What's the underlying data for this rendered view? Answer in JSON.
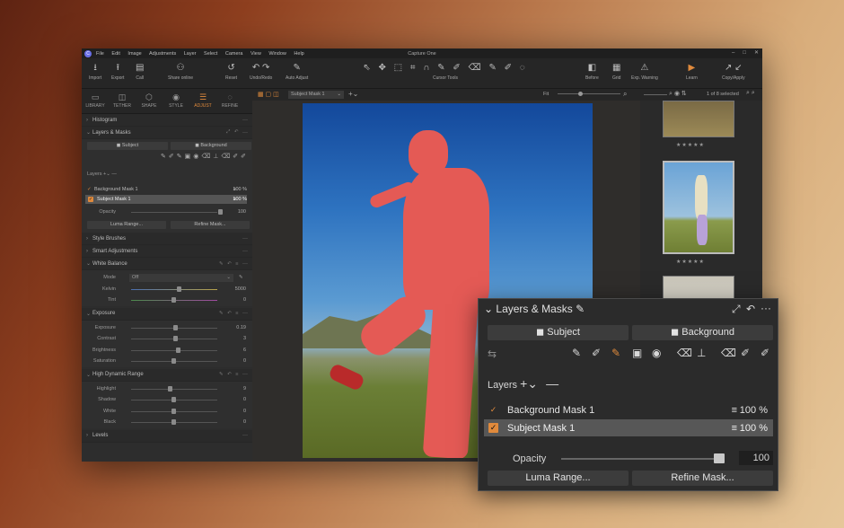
{
  "titlebar": {
    "menus": [
      "File",
      "Edit",
      "Image",
      "Adjustments",
      "Layer",
      "Select",
      "Camera",
      "View",
      "Window",
      "Help"
    ],
    "title": "Capture One",
    "controls": [
      "–",
      "□",
      "✕"
    ]
  },
  "toolbar": {
    "items": [
      {
        "name": "import-button",
        "icon": "⭳",
        "label": "Import"
      },
      {
        "name": "export-button",
        "icon": "⭱",
        "label": "Export"
      },
      {
        "name": "call-button",
        "icon": "▤",
        "label": "Call"
      },
      {
        "name": "share-online-button",
        "icon": "⚇",
        "label": "Share online"
      },
      {
        "name": "reset-button",
        "icon": "↺",
        "label": "Reset"
      },
      {
        "name": "undo-redo-button",
        "icon": "↶ ↷",
        "label": "Undo/Redo"
      },
      {
        "name": "auto-adjust-button",
        "icon": "✎",
        "label": "Auto Adjust"
      },
      {
        "name": "cursor-tools-button",
        "icon": "⇖ ✥ ⬚ ⌗ ∩ ✎ ✐ ⌫ ✎ ✐ ◌",
        "label": "Cursor Tools"
      },
      {
        "name": "before-button",
        "icon": "◧",
        "label": "Before"
      },
      {
        "name": "grid-button",
        "icon": "▦",
        "label": "Grid"
      },
      {
        "name": "exp-warning-button",
        "icon": "⚠",
        "label": "Exp. Warning"
      },
      {
        "name": "learn-button",
        "icon": "▶",
        "label": "Learn"
      },
      {
        "name": "copy-apply-button",
        "icon": "↗ ↙",
        "label": "Copy/Apply"
      }
    ]
  },
  "tabs": [
    {
      "icon": "▭",
      "label": "LIBRARY"
    },
    {
      "icon": "◫",
      "label": "TETHER"
    },
    {
      "icon": "⬡",
      "label": "SHAPE"
    },
    {
      "icon": "◉",
      "label": "STYLE"
    },
    {
      "icon": "☰",
      "label": "ADJUST"
    },
    {
      "icon": "◌",
      "label": "REFINE"
    }
  ],
  "left": {
    "histogram": "Histogram",
    "layers_masks": {
      "title": "Layers & Masks",
      "subject": "Subject",
      "background": "Background",
      "layers_label": "Layers",
      "layers": [
        {
          "name": "Background Mask 1",
          "value": "100 %"
        },
        {
          "name": "Subject Mask 1",
          "value": "100 %"
        }
      ],
      "opacity_label": "Opacity",
      "opacity_value": "100",
      "luma": "Luma Range...",
      "refine": "Refine Mask..."
    },
    "style_brushes": "Style Brushes",
    "smart_adjustments": "Smart Adjustments",
    "white_balance": {
      "title": "White Balance",
      "mode_label": "Mode",
      "mode_value": "Off",
      "kelvin_label": "Kelvin",
      "kelvin_value": "5000",
      "tint_label": "Tint",
      "tint_value": "0"
    },
    "exposure": {
      "title": "Exposure",
      "rows": [
        {
          "label": "Exposure",
          "value": "0.19"
        },
        {
          "label": "Contrast",
          "value": "3"
        },
        {
          "label": "Brightness",
          "value": "6"
        },
        {
          "label": "Saturation",
          "value": "0"
        }
      ]
    },
    "hdr": {
      "title": "High Dynamic Range",
      "rows": [
        {
          "label": "Highlight",
          "value": "9"
        },
        {
          "label": "Shadow",
          "value": "0"
        },
        {
          "label": "White",
          "value": "0"
        },
        {
          "label": "Black",
          "value": "0"
        }
      ]
    },
    "levels": "Levels"
  },
  "viewer": {
    "mask_select": "Subject Mask 1",
    "fit": "Fit"
  },
  "browser": {
    "count": "1 of 8 selected",
    "stars": "★★★★★"
  },
  "popup": {
    "title": "Layers & Masks",
    "subject": "Subject",
    "background": "Background",
    "layers_label": "Layers",
    "layers": [
      {
        "name": "Background Mask 1",
        "value": "100 %"
      },
      {
        "name": "Subject Mask 1",
        "value": "100 %"
      }
    ],
    "opacity_label": "Opacity",
    "opacity_value": "100",
    "luma": "Luma Range...",
    "refine": "Refine Mask...",
    "tool_icons": [
      "⇆",
      "✎",
      "✐",
      "✎",
      "▣",
      "◉",
      "⌫",
      "⊥",
      "⌫",
      "✐",
      "✐"
    ]
  }
}
